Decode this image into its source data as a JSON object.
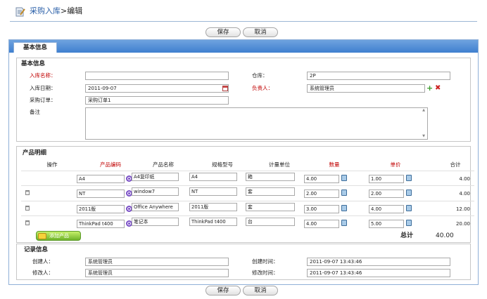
{
  "header": {
    "breadcrumb_section": "采购入库",
    "breadcrumb_sep": ">",
    "breadcrumb_page": "编辑"
  },
  "actions": {
    "save_label": "保存",
    "cancel_label": "取消"
  },
  "tab": {
    "label": "基本信息"
  },
  "basic": {
    "legend": "基本信息",
    "name_label": "入库名称：",
    "name_value": "",
    "warehouse_label": "仓库：",
    "warehouse_value": "2P",
    "date_label": "入库日期：",
    "date_value": "2011-09-07",
    "owner_label": "负责人：",
    "owner_value": "系统管理员",
    "order_label": "采购订单：",
    "order_value": "采购订单1",
    "remark_label": "备注",
    "remark_value": ""
  },
  "products": {
    "legend": "产品明细",
    "columns": [
      "操作",
      "产品编码",
      "产品名称",
      "规格型号",
      "计量单位",
      "数量",
      "单价",
      "合计"
    ],
    "rows": [
      {
        "code": "A4",
        "name": "A4复印纸",
        "spec": "A4",
        "unit": "箱",
        "qty": "4.00",
        "price": "1.00",
        "total": "4.00"
      },
      {
        "code": "NT",
        "name": "window7",
        "spec": "NT",
        "unit": "套",
        "qty": "2.00",
        "price": "2.00",
        "total": "4.00"
      },
      {
        "code": "2011版",
        "name": "Office Anywhere",
        "spec": "2011版",
        "unit": "套",
        "qty": "3.00",
        "price": "4.00",
        "total": "12.00"
      },
      {
        "code": "ThinkPad t400",
        "name": "笔记本",
        "spec": "ThinkPad t400",
        "unit": "台",
        "qty": "4.00",
        "price": "5.00",
        "total": "20.00"
      }
    ],
    "add_label": "添加产品",
    "sum_label": "总计",
    "sum_value": "40.00"
  },
  "record": {
    "legend": "记录信息",
    "creator_label": "创建人：",
    "creator_value": "系统管理员",
    "created_label": "创建时间：",
    "created_value": "2011-09-07 13:43:46",
    "modifier_label": "修改人：",
    "modifier_value": "系统管理员",
    "modified_label": "修改时间：",
    "modified_value": "2011-09-07 13:43:46"
  },
  "colors": {
    "accent": "#2a5fa8",
    "required": "#c00000",
    "tab_strip": "#4f8fd8"
  },
  "icons": [
    "document-icon",
    "calendar-icon",
    "add-icon",
    "delete-icon",
    "search-icon",
    "calculator-icon",
    "trash-icon"
  ]
}
